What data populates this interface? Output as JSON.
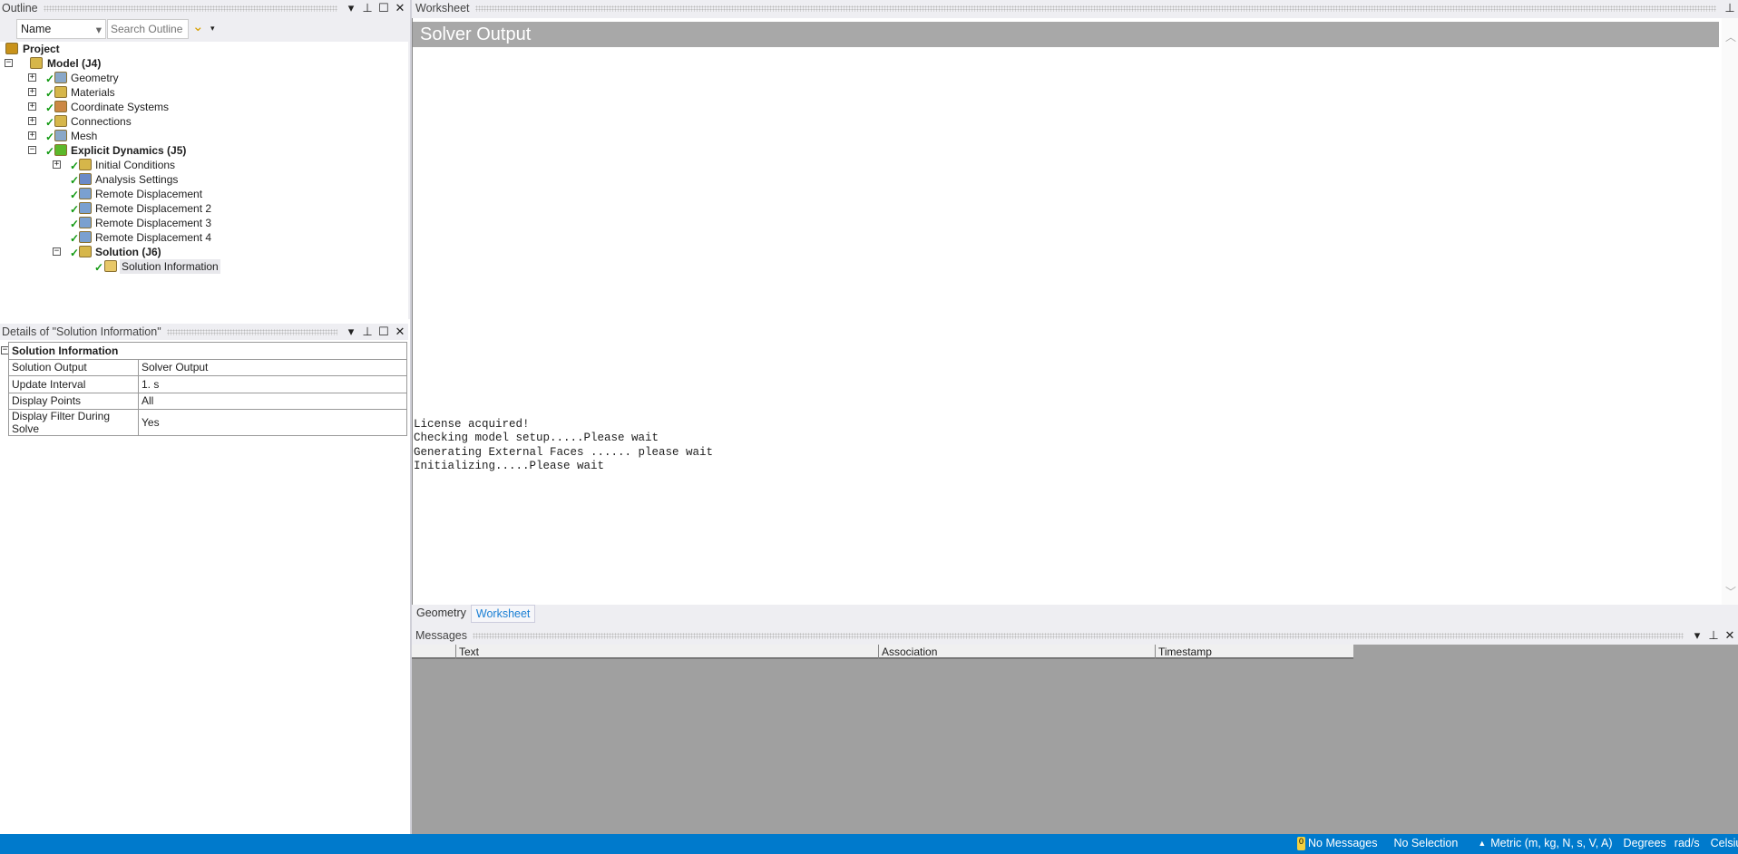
{
  "outline": {
    "title": "Outline",
    "filter_select": "Name",
    "search_placeholder": "Search Outline",
    "tree": [
      {
        "label": "Project",
        "bold": true,
        "level": 0
      },
      {
        "label": "Model (J4)",
        "bold": true,
        "level": 1
      },
      {
        "label": "Geometry",
        "level": 2
      },
      {
        "label": "Materials",
        "level": 2
      },
      {
        "label": "Coordinate Systems",
        "level": 2
      },
      {
        "label": "Connections",
        "level": 2
      },
      {
        "label": "Mesh",
        "level": 2
      },
      {
        "label": "Explicit Dynamics (J5)",
        "bold": true,
        "level": 2
      },
      {
        "label": "Initial Conditions",
        "level": 3
      },
      {
        "label": "Analysis Settings",
        "level": 3
      },
      {
        "label": "Remote Displacement",
        "level": 3
      },
      {
        "label": "Remote Displacement 2",
        "level": 3
      },
      {
        "label": "Remote Displacement 3",
        "level": 3
      },
      {
        "label": "Remote Displacement 4",
        "level": 3
      },
      {
        "label": "Solution (J6)",
        "bold": true,
        "level": 3
      },
      {
        "label": "Solution Information",
        "level": 4,
        "selected": true
      }
    ]
  },
  "details": {
    "title": "Details of \"Solution Information\"",
    "group": "Solution Information",
    "rows": [
      {
        "k": "Solution Output",
        "v": "Solver Output"
      },
      {
        "k": "Update Interval",
        "v": "1. s"
      },
      {
        "k": "Display Points",
        "v": "All"
      },
      {
        "k": "Display Filter During Solve",
        "v": "Yes"
      }
    ]
  },
  "worksheet": {
    "title": "Worksheet",
    "banner": "Solver Output",
    "lines": [
      "License acquired!",
      "Checking model setup.....Please wait",
      "Generating External Faces ...... please wait",
      "Initializing.....Please wait"
    ]
  },
  "tabs": [
    {
      "label": "Geometry"
    },
    {
      "label": "Worksheet",
      "active": true
    }
  ],
  "messages": {
    "title": "Messages",
    "columns": [
      "Text",
      "Association",
      "Timestamp"
    ]
  },
  "status": {
    "messages": "No Messages",
    "message_count": "0",
    "selection": "No Selection",
    "units": "Metric (m, kg, N, s, V, A)",
    "angle": "Degrees",
    "rot": "rad/s",
    "temp": "Celsius"
  }
}
